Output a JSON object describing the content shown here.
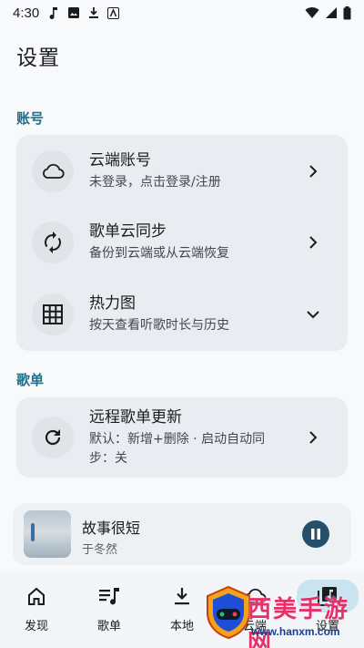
{
  "status_bar": {
    "time": "4:30"
  },
  "page": {
    "title": "设置"
  },
  "sections": [
    {
      "label": "账号",
      "items": [
        {
          "title": "云端账号",
          "subtitle": "未登录，点击登录/注册",
          "icon": "cloud-icon",
          "trailing": "chevron-right"
        },
        {
          "title": "歌单云同步",
          "subtitle": "备份到云端或从云端恢复",
          "icon": "sync-icon",
          "trailing": "chevron-right"
        },
        {
          "title": "热力图",
          "subtitle": "按天查看听歌时长与历史",
          "icon": "grid-icon",
          "trailing": "chevron-down"
        }
      ]
    },
    {
      "label": "歌单",
      "items": [
        {
          "title": "远程歌单更新",
          "subtitle_line1": "默认：新增+删除 · 启动自动同",
          "subtitle_line2": "步：关",
          "icon": "refresh-icon",
          "trailing": "chevron-right"
        }
      ]
    }
  ],
  "player": {
    "song": "故事很短",
    "artist": "于冬然",
    "state_icon": "pause-icon"
  },
  "bottom_nav": [
    {
      "label": "发现",
      "icon": "home-icon",
      "active": false
    },
    {
      "label": "歌单",
      "icon": "playlist-icon",
      "active": false
    },
    {
      "label": "本地",
      "icon": "download-icon",
      "active": false
    },
    {
      "label": "云端",
      "icon": "cloud-icon",
      "active": false
    },
    {
      "label": "设置",
      "icon": "library-music-icon",
      "active": true
    }
  ],
  "watermark": {
    "title": "西美手游网",
    "url": "www.hanxm.com"
  },
  "colors": {
    "accent": "#1f6f86",
    "card": "#e9edf1",
    "nav_active": "#c9e3ef",
    "pause_button": "#24506a"
  }
}
